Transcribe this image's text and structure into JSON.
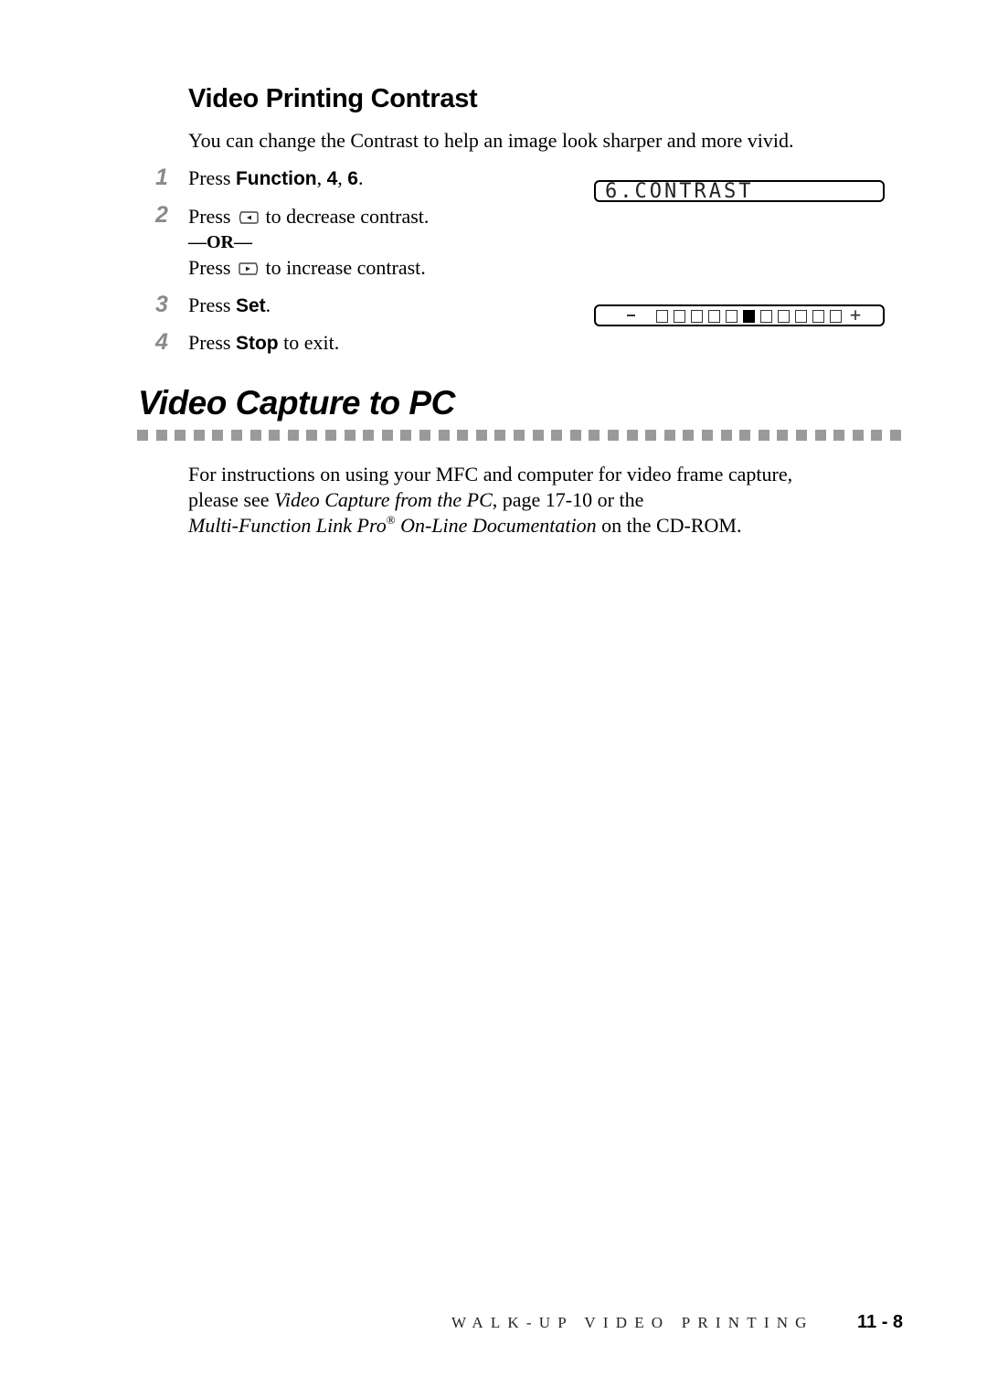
{
  "section": {
    "heading": "Video Printing Contrast",
    "intro": "You can change the Contrast to help an image look sharper and more vivid.",
    "steps": [
      {
        "num": "1",
        "pre": "Press ",
        "bold": "Function",
        "mid": ", ",
        "bold2": "4",
        "mid2": ", ",
        "bold3": "6",
        "post": "."
      },
      {
        "num": "2",
        "pre": "Press",
        "icon": "left-arrow-key-icon",
        "post": "to decrease contrast."
      },
      {
        "or_label": "—OR—"
      },
      {
        "pre": "Press",
        "icon": "right-arrow-key-icon",
        "post": "to increase contrast."
      },
      {
        "num": "3",
        "pre": "Press ",
        "bold": "Set",
        "post": "."
      },
      {
        "num": "4",
        "pre": "Press ",
        "bold": "Stop",
        "post": " to exit."
      }
    ],
    "lcd_menu": "6.CONTRAST",
    "lcd_contrast": {
      "minus_label": "-",
      "plus_label": "+",
      "segments": 11,
      "selected_index": 5
    }
  },
  "chapter_section": {
    "title": "Video Capture to PC",
    "paragraph": {
      "line1": "For instructions on using your MFC and computer for video frame capture,",
      "line2_pre": "please see ",
      "line2_italic": "Video Capture from the PC",
      "line2_post": ", page 17-10 or the",
      "line3_italic_a": "Multi-Function Link Pro",
      "line3_sup": "®",
      "line3_italic_b": " On-Line Documentation",
      "line3_post": " on the CD-ROM."
    }
  },
  "footer": {
    "chapter_label": "WALK-UP VIDEO PRINTING",
    "page_number": "11 - 8"
  },
  "colors": {
    "step_number": "#8a8a8a",
    "divider": "#9a9a9a"
  }
}
